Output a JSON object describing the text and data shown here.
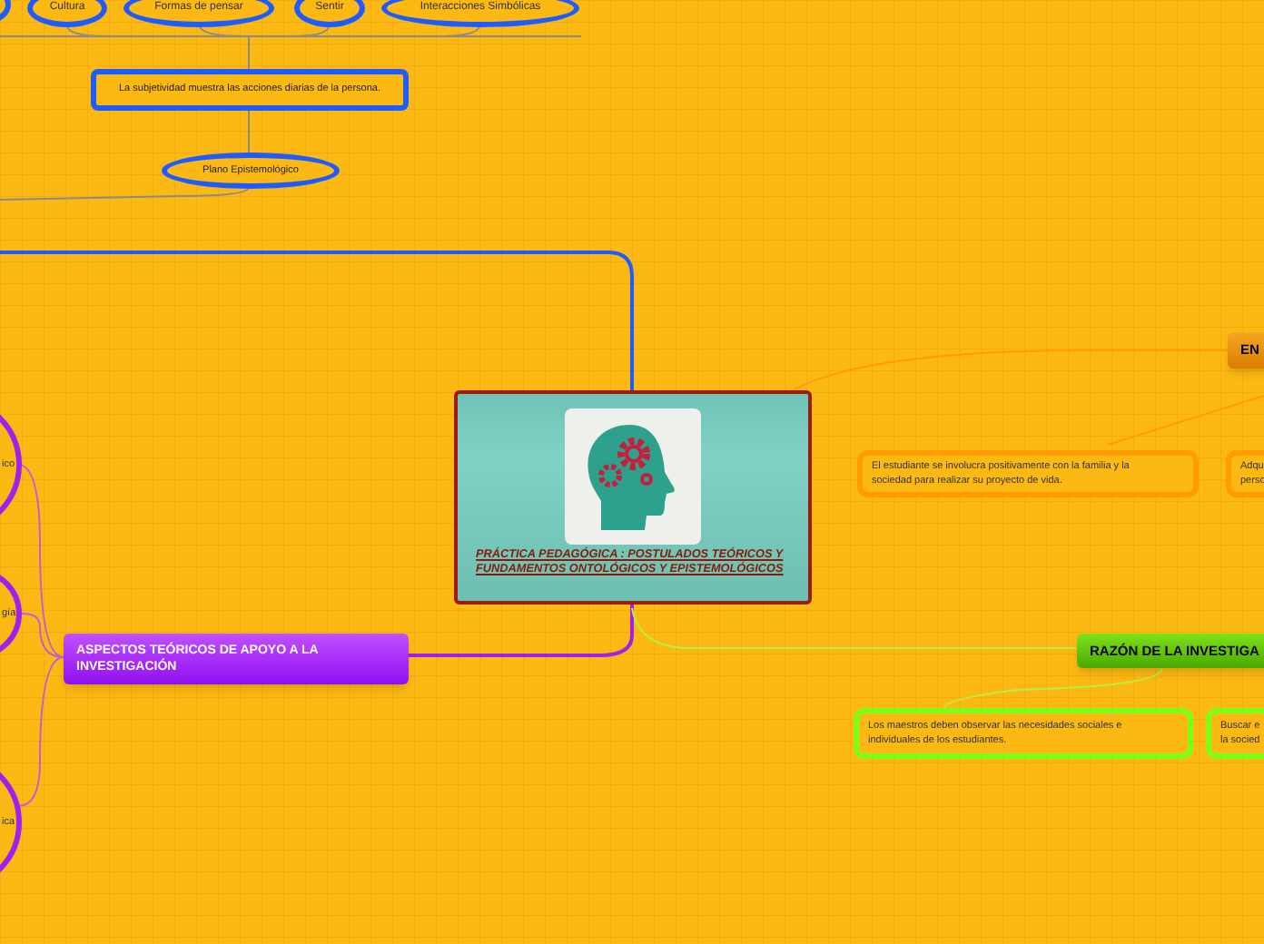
{
  "top_branch": {
    "clouds": [
      {
        "label": "Cultura"
      },
      {
        "label": "Formas de pensar"
      },
      {
        "label": "Sentir"
      },
      {
        "label": "Interacciones Simbólicas"
      }
    ],
    "subjectivity": "La subjetividad muestra las acciones diarias de la persona.",
    "plane": "Plano Epistemológico"
  },
  "central": {
    "title": "PRÁCTICA PEDAGÓGICA : POSTULADOS TEÓRICOS Y FUNDAMENTOS ONTOLÓGICOS Y EPISTEMOLÓGICOS"
  },
  "right_branches": [
    {
      "kind": "orange",
      "label": "EN",
      "children": [
        {
          "lines": [
            "El estudiante se involucra positivamente con la familia y la",
            "sociedad para realizar su proyecto de vida."
          ]
        },
        {
          "lines": [
            "Adqu",
            "perso"
          ]
        }
      ]
    },
    {
      "kind": "green",
      "label": "RAZÓN DE LA INVESTIGA",
      "children": [
        {
          "lines": [
            "Los maestros deben observar las necesidades sociales e",
            "individuales de los estudiantes."
          ]
        },
        {
          "lines": [
            "Buscar e",
            "la socied"
          ]
        }
      ]
    }
  ],
  "left_branch": {
    "label": "ASPECTOS TEÓRICOS DE APOYO A LA INVESTIGACIÓN",
    "children": [
      {
        "label": "ico"
      },
      {
        "label": "gía"
      },
      {
        "label": "ica"
      }
    ]
  }
}
